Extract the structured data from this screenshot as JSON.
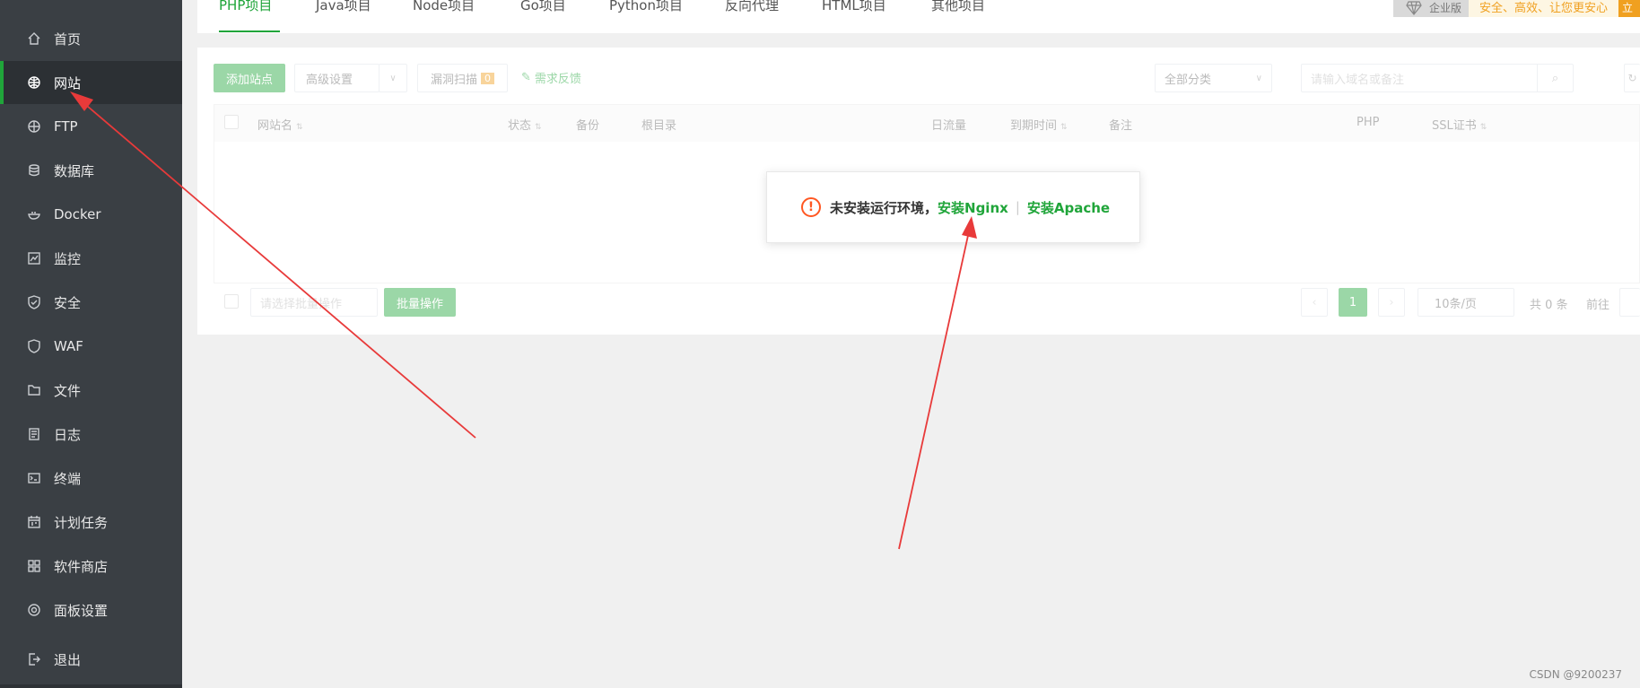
{
  "sidebar": {
    "items": [
      {
        "label": "首页",
        "icon": "home-icon"
      },
      {
        "label": "网站",
        "icon": "globe-icon",
        "active": true
      },
      {
        "label": "FTP",
        "icon": "ftp-icon"
      },
      {
        "label": "数据库",
        "icon": "database-icon"
      },
      {
        "label": "Docker",
        "icon": "docker-icon"
      },
      {
        "label": "监控",
        "icon": "monitor-icon"
      },
      {
        "label": "安全",
        "icon": "shield-icon"
      },
      {
        "label": "WAF",
        "icon": "waf-icon"
      },
      {
        "label": "文件",
        "icon": "folder-icon"
      },
      {
        "label": "日志",
        "icon": "log-icon"
      },
      {
        "label": "终端",
        "icon": "terminal-icon"
      },
      {
        "label": "计划任务",
        "icon": "calendar-icon"
      },
      {
        "label": "软件商店",
        "icon": "grid-icon"
      },
      {
        "label": "面板设置",
        "icon": "gear-icon"
      },
      {
        "label": "退出",
        "icon": "logout-icon"
      }
    ]
  },
  "tabs": [
    "PHP项目",
    "Java项目",
    "Node项目",
    "Go项目",
    "Python项目",
    "反向代理",
    "HTML项目",
    "其他项目"
  ],
  "promo": {
    "badge": "企业版",
    "text": "安全、高效、让您更安心",
    "button": "立"
  },
  "toolbar": {
    "add_site": "添加站点",
    "advanced": "高级设置",
    "vuln_scan": "漏洞扫描",
    "vuln_count": "0",
    "feedback": "需求反馈",
    "category": "全部分类",
    "search_placeholder": "请输入域名或备注"
  },
  "table": {
    "columns": {
      "name": "网站名",
      "status": "状态",
      "backup": "备份",
      "root": "根目录",
      "traffic": "日流量",
      "expire": "到期时间",
      "remark": "备注",
      "php": "PHP",
      "ssl": "SSL证书"
    }
  },
  "footer": {
    "batch_select": "请选择批量操作",
    "batch_btn": "批量操作",
    "page": "1",
    "per_page": "10条/页",
    "total": "共 0 条",
    "goto": "前往"
  },
  "toast": {
    "message": "未安装运行环境，",
    "install_nginx": "安装Nginx",
    "install_apache": "安装Apache"
  },
  "watermark": "CSDN @9200237",
  "colors": {
    "accent": "#20a53a",
    "sidebar": "#3a3f44",
    "warning": "#ff5722",
    "annotation": "#e83a3a"
  }
}
